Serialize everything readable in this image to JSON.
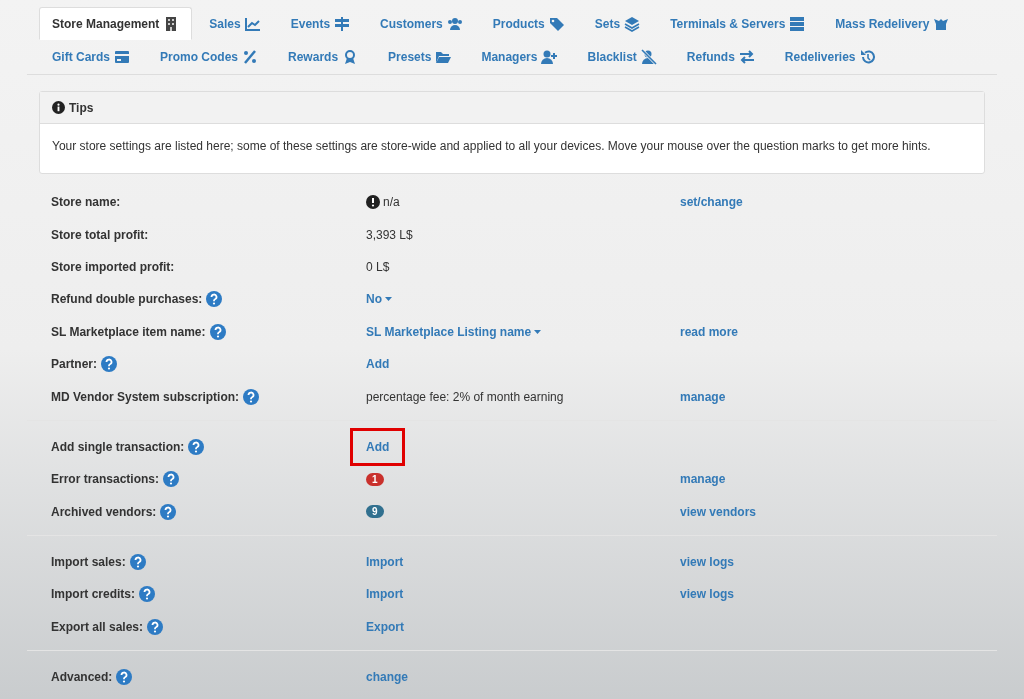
{
  "tabs": [
    {
      "label": "Store Management",
      "selected": true
    },
    {
      "label": "Sales",
      "selected": false
    },
    {
      "label": "Events",
      "selected": false
    },
    {
      "label": "Customers",
      "selected": false
    },
    {
      "label": "Products",
      "selected": false
    },
    {
      "label": "Sets",
      "selected": false
    },
    {
      "label": "Terminals & Servers",
      "selected": false
    },
    {
      "label": "Mass Redelivery",
      "selected": false
    },
    {
      "label": "Gift Cards",
      "selected": false
    },
    {
      "label": "Promo Codes",
      "selected": false
    },
    {
      "label": "Rewards",
      "selected": false
    },
    {
      "label": "Presets",
      "selected": false
    },
    {
      "label": "Managers",
      "selected": false
    },
    {
      "label": "Blacklist",
      "selected": false
    },
    {
      "label": "Refunds",
      "selected": false
    },
    {
      "label": "Redeliveries",
      "selected": false
    }
  ],
  "tips": {
    "title": "Tips",
    "text": "Your store settings are listed here; some of these settings are store-wide and applied to all your devices. Move your mouse over the question marks to get more hints."
  },
  "sections": [
    {
      "rows": [
        {
          "label": "Store name:",
          "help": false,
          "value": {
            "kind": "warning",
            "text": "n/a"
          },
          "action": "set/change"
        },
        {
          "label": "Store total profit:",
          "help": false,
          "value": {
            "kind": "text",
            "text": "3,393 L$"
          }
        },
        {
          "label": "Store imported profit:",
          "help": false,
          "value": {
            "kind": "text",
            "text": "0 L$"
          }
        },
        {
          "label": "Refund double purchases:",
          "help": true,
          "value": {
            "kind": "dropdown",
            "text": "No"
          }
        },
        {
          "label": "SL Marketplace item name:",
          "help": true,
          "value": {
            "kind": "dropdown",
            "text": "SL Marketplace Listing name"
          },
          "action": "read more"
        },
        {
          "label": "Partner:",
          "help": true,
          "value": {
            "kind": "link",
            "text": "Add"
          }
        },
        {
          "label": "MD Vendor System subscription:",
          "help": true,
          "value": {
            "kind": "text",
            "text": "percentage fee: 2% of month earning"
          },
          "action": "manage"
        }
      ]
    },
    {
      "rows": [
        {
          "label": "Add single transaction:",
          "help": true,
          "value": {
            "kind": "link",
            "text": "Add",
            "highlighted": true
          }
        },
        {
          "label": "Error transactions:",
          "help": true,
          "value": {
            "kind": "badge",
            "text": "1",
            "color": "#c9302c"
          },
          "action": "manage"
        },
        {
          "label": "Archived vendors:",
          "help": true,
          "value": {
            "kind": "badge",
            "text": "9",
            "color": "#31708f"
          },
          "action": "view vendors"
        }
      ]
    },
    {
      "rows": [
        {
          "label": "Import sales:",
          "help": true,
          "value": {
            "kind": "link",
            "text": "Import"
          },
          "action": "view logs"
        },
        {
          "label": "Import credits:",
          "help": true,
          "value": {
            "kind": "link",
            "text": "Import"
          },
          "action": "view logs"
        },
        {
          "label": "Export all sales:",
          "help": true,
          "value": {
            "kind": "link",
            "text": "Export"
          }
        }
      ]
    },
    {
      "rows": [
        {
          "label": "Advanced:",
          "help": true,
          "value": {
            "kind": "link",
            "text": "change"
          }
        }
      ]
    }
  ]
}
